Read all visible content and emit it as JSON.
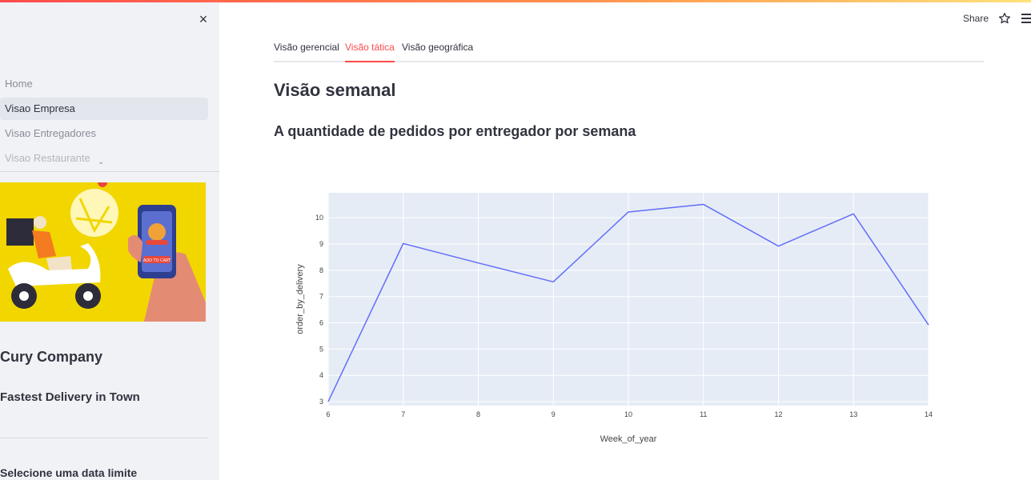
{
  "sidebar": {
    "close_label": "×",
    "nav_items": [
      {
        "label": "Home",
        "state": "normal"
      },
      {
        "label": "Visao Empresa",
        "state": "active"
      },
      {
        "label": "Visao Entregadores",
        "state": "normal"
      },
      {
        "label": "Visao Restaurante",
        "state": "faded"
      }
    ],
    "nav_more": "⌄",
    "company": "Cury Company",
    "tagline": "Fastest Delivery in Town",
    "date_label": "Selecione uma data limite",
    "illustration_text": "ADD TO CART"
  },
  "toolbar": {
    "share_label": "Share",
    "star_icon": "star-icon",
    "menu_icon": "hamburger-menu-icon"
  },
  "tabs": [
    {
      "label": "Visão gerencial",
      "active": false
    },
    {
      "label": "Visão tática",
      "active": true
    },
    {
      "label": "Visão geográfica",
      "active": false
    }
  ],
  "main": {
    "title": "Visão semanal",
    "subtitle": "A quantidade de pedidos por entregador por semana"
  },
  "colors": {
    "accent": "#ff4b4b",
    "line": "#636efa",
    "plot_bg": "#e5ecf6",
    "sidebar_bg": "#f0f2f6"
  },
  "chart_data": {
    "type": "line",
    "title": "",
    "xlabel": "Week_of_year",
    "ylabel": "order_by_delivery",
    "x": [
      6,
      7,
      8,
      9,
      10,
      11,
      12,
      13,
      14
    ],
    "series": [
      {
        "values": [
          3.0,
          9.02,
          8.28,
          7.56,
          10.22,
          10.51,
          8.92,
          10.15,
          5.92
        ]
      }
    ],
    "xlim": [
      6,
      14
    ],
    "ylim": [
      2.85,
      10.95
    ],
    "xticks": [
      6,
      7,
      8,
      9,
      10,
      11,
      12,
      13,
      14
    ],
    "yticks": [
      3,
      4,
      5,
      6,
      7,
      8,
      9,
      10
    ],
    "grid": true,
    "legend": "none"
  }
}
